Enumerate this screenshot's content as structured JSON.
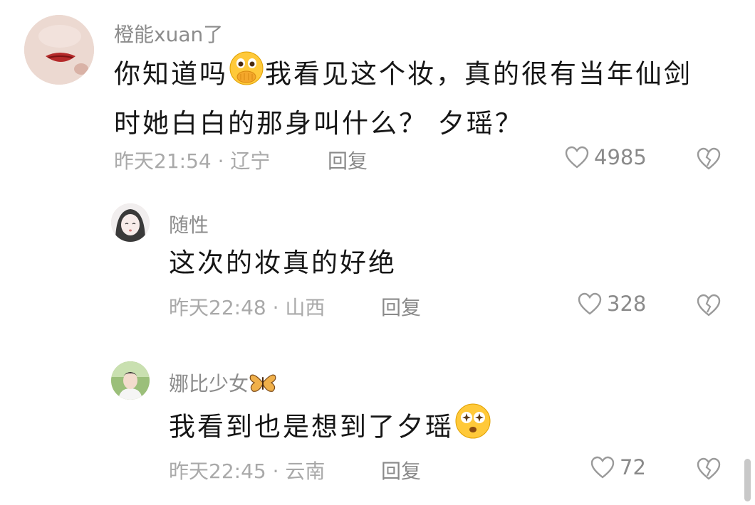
{
  "comments": [
    {
      "username": "橙能xuan了",
      "line1_before": "你知道吗",
      "line1_after": "我看见这个妆，真的很有当年仙剑",
      "line2": "时她白白的那身叫什么？ 夕瑶？",
      "emoji": "covering-mouth-emoji",
      "time": "昨天21:54",
      "sep": "·",
      "location": "辽宁",
      "reply_label": "回复",
      "likes": "4985"
    },
    {
      "username": "随性",
      "text": "这次的妆真的好绝",
      "time": "昨天22:48",
      "sep": "·",
      "location": "山西",
      "reply_label": "回复",
      "likes": "328"
    },
    {
      "username": "娜比少女",
      "username_emoji": "butterfly-emoji",
      "text": "我看到也是想到了夕瑶",
      "text_emoji": "starry-eyes-emoji",
      "time": "昨天22:45",
      "sep": "·",
      "location": "云南",
      "reply_label": "回复",
      "likes": "72"
    }
  ],
  "icons": {
    "like": "heart-outline-icon",
    "dislike": "broken-heart-icon"
  },
  "colors": {
    "text": "#161616",
    "meta": "#a9a9a9",
    "icon": "#9a9a9a"
  }
}
